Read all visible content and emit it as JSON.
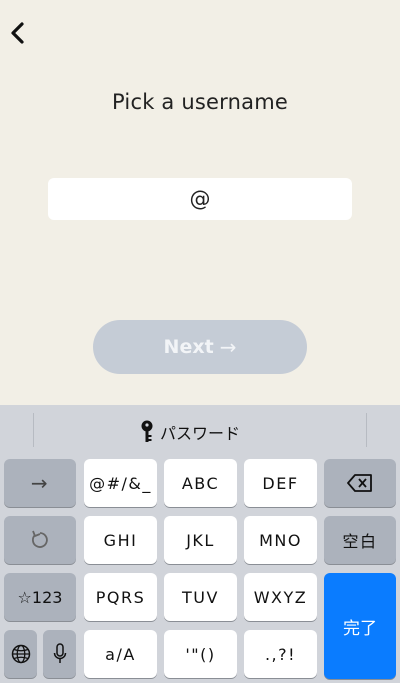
{
  "screen": {
    "title": "Pick a username",
    "username_value": "@",
    "next_label": "Next",
    "next_arrow": "→"
  },
  "keyboard": {
    "suggestion_label": "パスワード",
    "suggestion_icon": "key-icon",
    "row1": [
      "→",
      "@#/&_",
      "ABC",
      "DEF",
      "⌫"
    ],
    "row2": [
      "↺",
      "GHI",
      "JKL",
      "MNO",
      "空白"
    ],
    "row3": [
      "☆123",
      "PQRS",
      "TUV",
      "WXYZ"
    ],
    "row4": [
      "globe",
      "mic",
      "a/A",
      "'\"()",
      ".,?!"
    ],
    "done_label": "完了",
    "colors": {
      "done_key": "#0A7CFF",
      "next_button": "#C5CCD6",
      "background": "#F2EFE6"
    }
  }
}
